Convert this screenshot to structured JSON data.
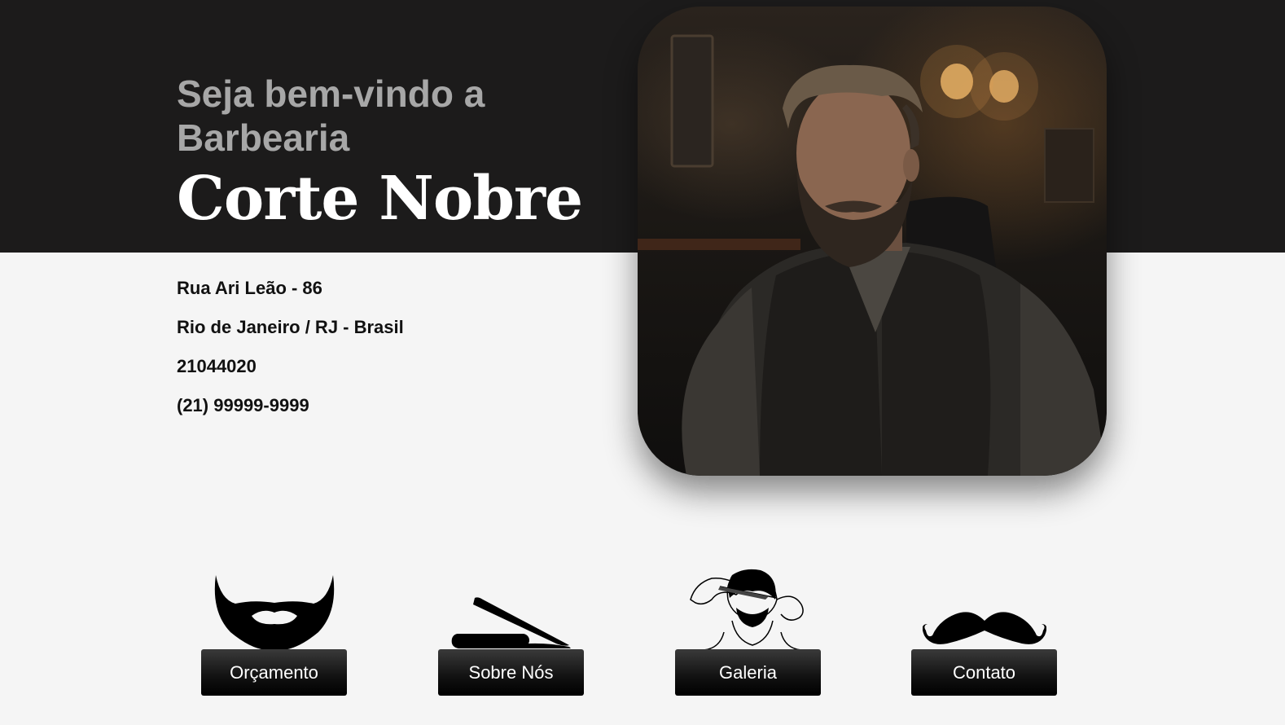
{
  "hero": {
    "welcome": "Seja bem-vindo a Barbearia",
    "brand": "Corte Nobre"
  },
  "address": {
    "street": "Rua Ari Leão - 86",
    "city": "Rio de Janeiro / RJ - Brasil",
    "zip": "21044020",
    "phone": "(21) 99999-9999"
  },
  "services": [
    {
      "label": "Orçamento",
      "icon": "beard-icon"
    },
    {
      "label": "Sobre Nós",
      "icon": "straight-razor-icon"
    },
    {
      "label": "Galeria",
      "icon": "haircut-icon"
    },
    {
      "label": "Contato",
      "icon": "mustache-icon"
    }
  ],
  "colors": {
    "header_bg": "#1c1b1b",
    "page_bg": "#f5f5f5",
    "welcome_text": "#a7a7a7",
    "brand_text": "#ffffff",
    "button_bg": "#111111"
  }
}
